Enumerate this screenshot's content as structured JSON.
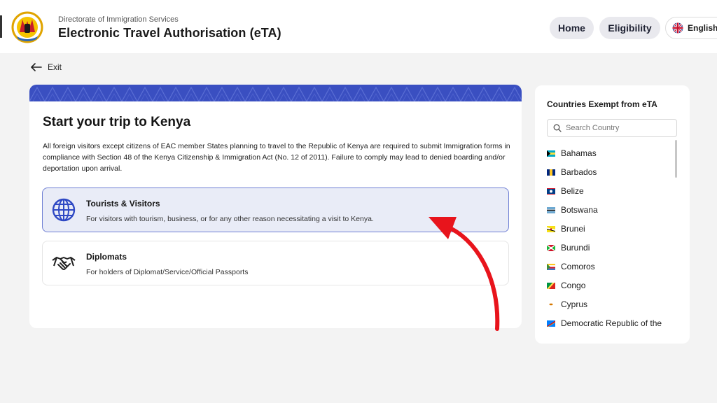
{
  "header": {
    "department": "Directorate of Immigration Services",
    "title": "Electronic Travel Authorisation (eTA)",
    "nav": {
      "home": "Home",
      "eligibility": "Eligibility"
    },
    "language": "English"
  },
  "exit_label": "Exit",
  "main": {
    "heading": "Start your trip to Kenya",
    "description": "All foreign visitors except citizens of EAC member States planning to travel to the Republic of Kenya are required to submit Immigration forms in compliance with Section 48 of the Kenya Citizenship & Immigration Act (No. 12 of 2011). Failure to comply may lead to denied boarding and/or deportation upon arrival.",
    "options": [
      {
        "title": "Tourists & Visitors",
        "description": "For visitors with tourism, business, or for any other reason necessitating a visit to Kenya.",
        "selected": true
      },
      {
        "title": "Diplomats",
        "description": "For holders of Diplomat/Service/Official Passports",
        "selected": false
      }
    ]
  },
  "sidebar": {
    "title": "Countries Exempt from eTA",
    "search_placeholder": "Search Country",
    "countries": [
      {
        "name": "Bahamas"
      },
      {
        "name": "Barbados"
      },
      {
        "name": "Belize"
      },
      {
        "name": "Botswana"
      },
      {
        "name": "Brunei"
      },
      {
        "name": "Burundi"
      },
      {
        "name": "Comoros"
      },
      {
        "name": "Congo"
      },
      {
        "name": "Cyprus"
      },
      {
        "name": "Democratic Republic of the"
      }
    ]
  },
  "colors": {
    "accent": "#3a4fc1",
    "selected_bg": "#e9ecf7",
    "annotation_arrow": "#e8141c"
  }
}
